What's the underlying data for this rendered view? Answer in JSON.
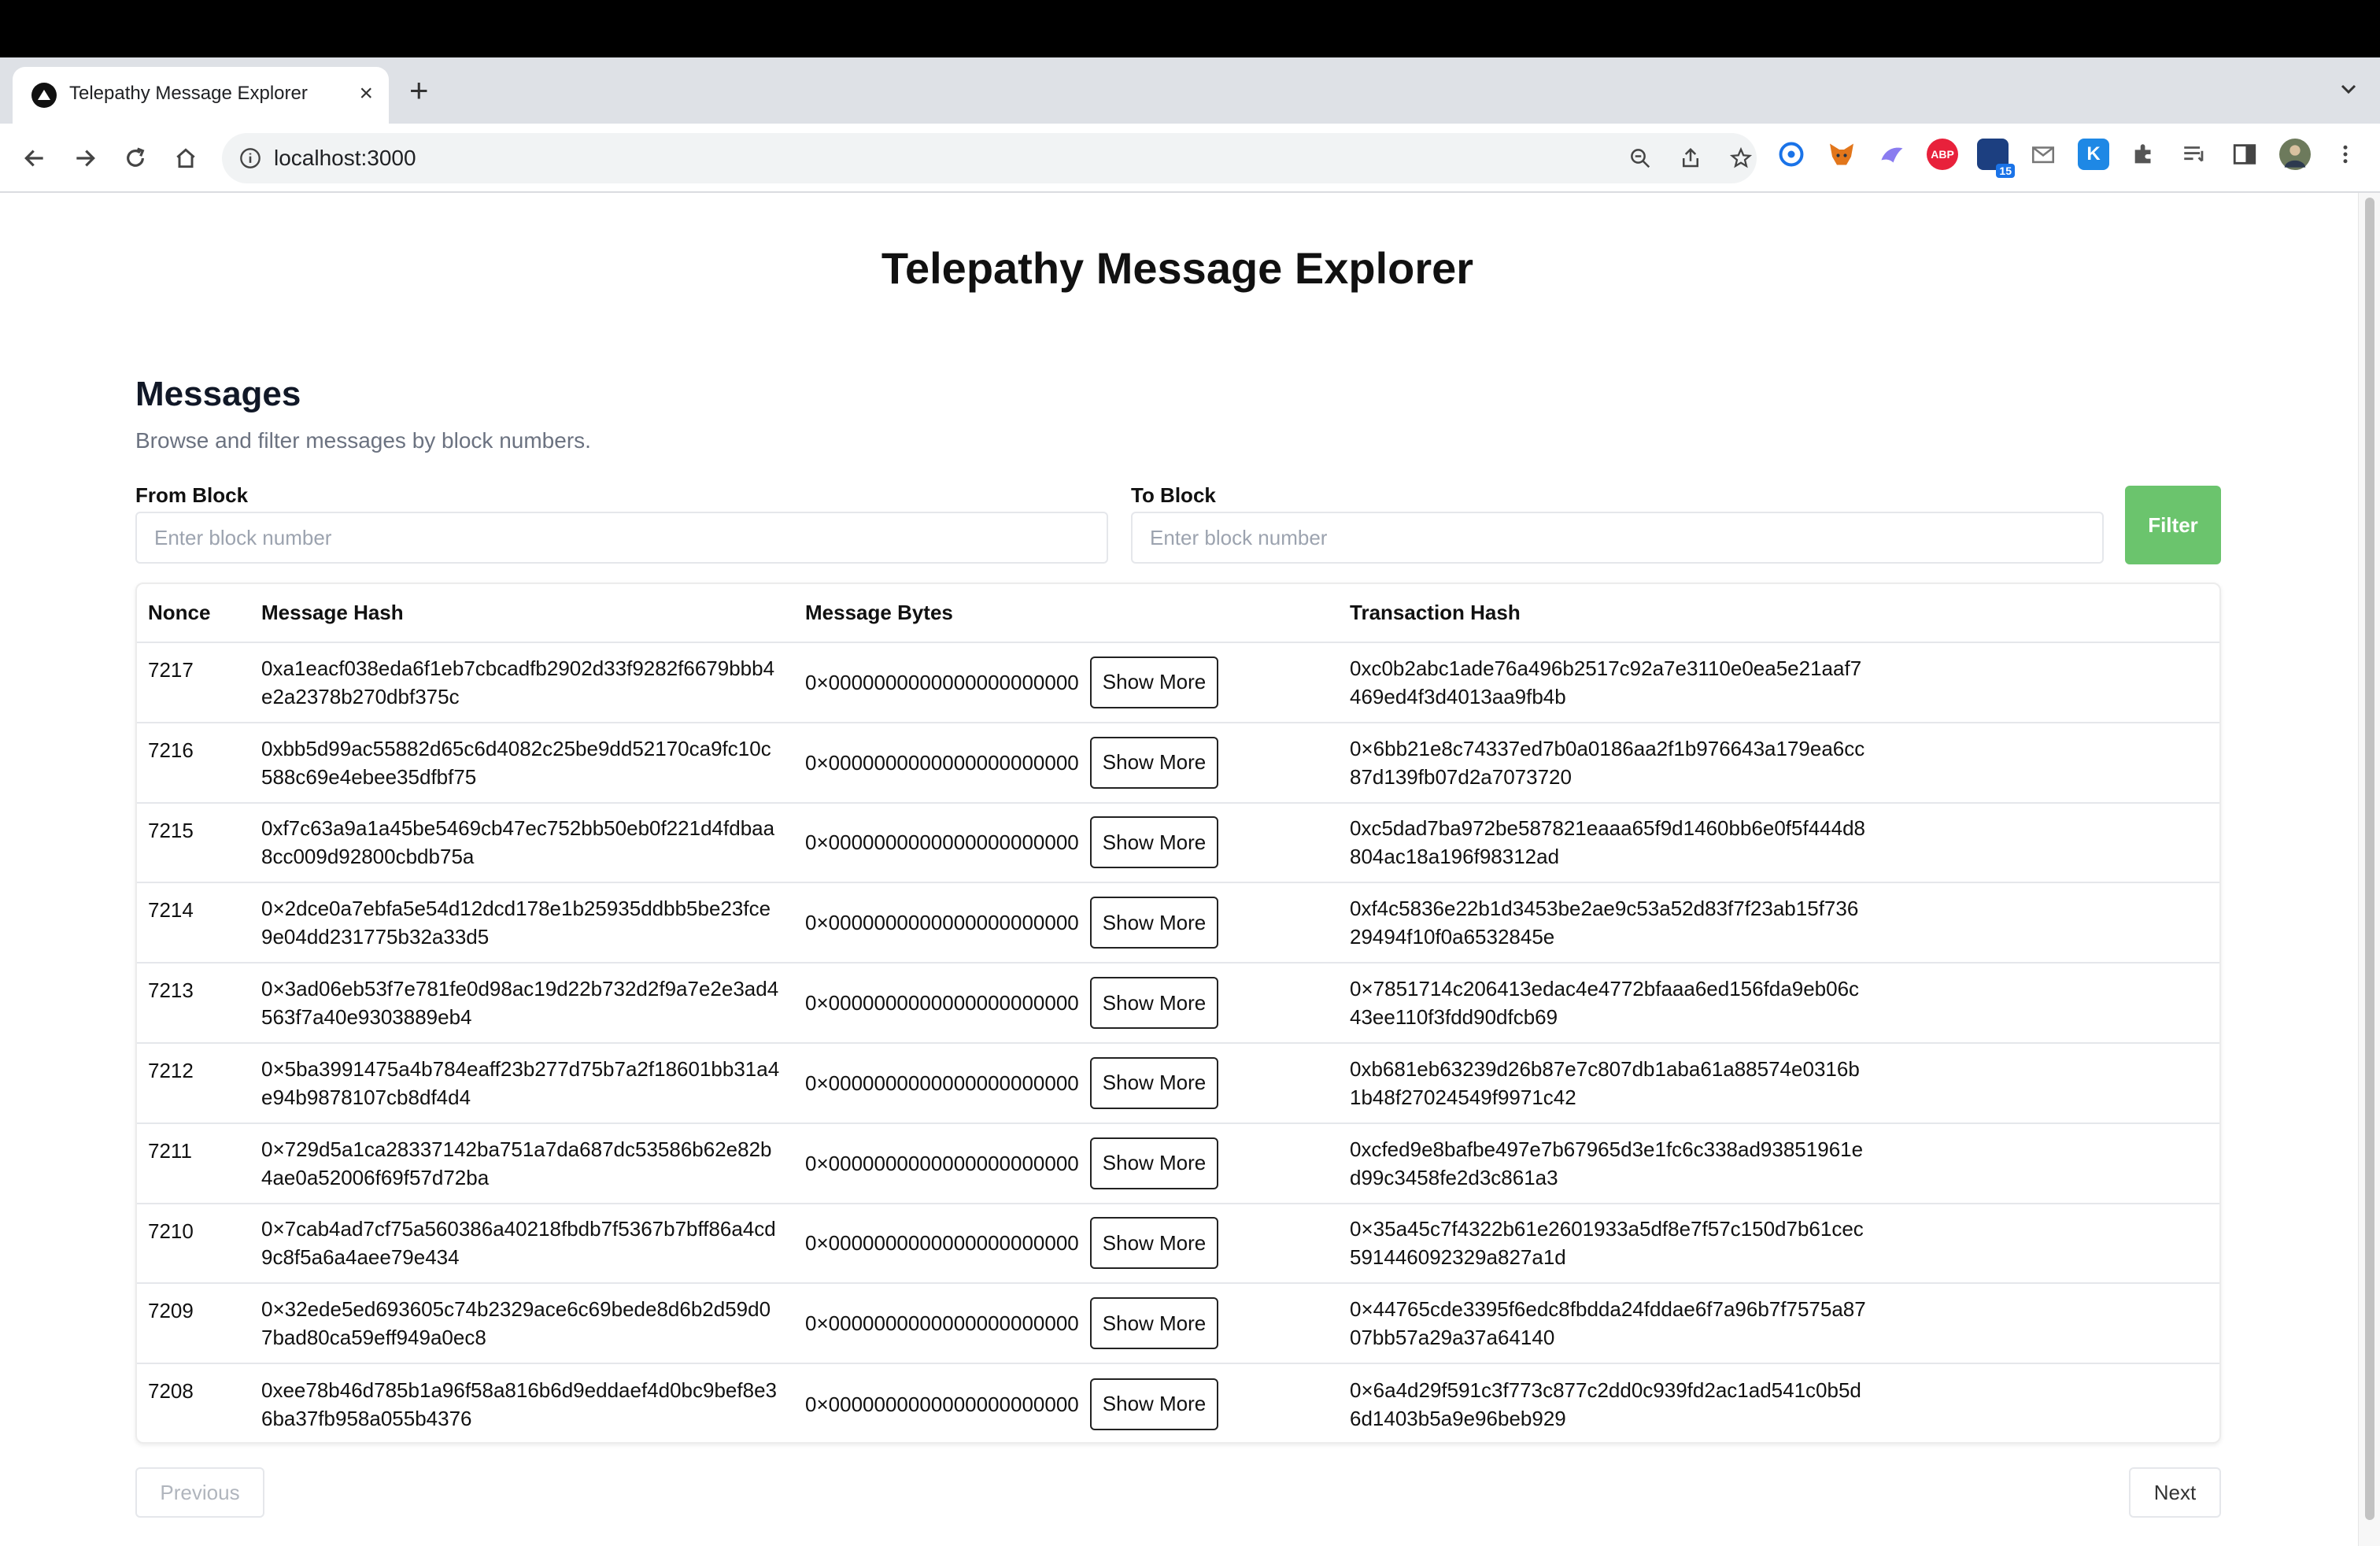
{
  "browser": {
    "tab_title": "Telepathy Message Explorer",
    "tab_close": "×",
    "new_tab": "+",
    "url": "localhost:3000",
    "badge_count": "15",
    "abp_label": "ABP",
    "k_label": "K"
  },
  "page": {
    "title": "Telepathy Message Explorer",
    "section_title": "Messages",
    "section_subtitle": "Browse and filter messages by block numbers."
  },
  "filter": {
    "from_label": "From Block",
    "from_placeholder": "Enter block number",
    "to_label": "To Block",
    "to_placeholder": "Enter block number",
    "button_label": "Filter"
  },
  "table": {
    "headers": {
      "nonce": "Nonce",
      "message_hash": "Message Hash",
      "message_bytes": "Message Bytes",
      "transaction_hash": "Transaction Hash"
    },
    "show_more_label": "Show More",
    "rows": [
      {
        "nonce": "7217",
        "message_hash": "0xa1eacf038eda6f1eb7cbcadfb2902d33f9282f6679bbb4e2a2378b270dbf375c",
        "message_bytes": "0×0000000000000000000000",
        "transaction_hash": "0xc0b2abc1ade76a496b2517c92a7e3110e0ea5e21aaf7469ed4f3d4013aa9fb4b"
      },
      {
        "nonce": "7216",
        "message_hash": "0xbb5d99ac55882d65c6d4082c25be9dd52170ca9fc10c588c69e4ebee35dfbf75",
        "message_bytes": "0×0000000000000000000000",
        "transaction_hash": "0×6bb21e8c74337ed7b0a0186aa2f1b976643a179ea6cc87d139fb07d2a7073720"
      },
      {
        "nonce": "7215",
        "message_hash": "0xf7c63a9a1a45be5469cb47ec752bb50eb0f221d4fdbaa8cc009d92800cbdb75a",
        "message_bytes": "0×0000000000000000000000",
        "transaction_hash": "0xc5dad7ba972be587821eaaa65f9d1460bb6e0f5f444d8804ac18a196f98312ad"
      },
      {
        "nonce": "7214",
        "message_hash": "0×2dce0a7ebfa5e54d12dcd178e1b25935ddbb5be23fce9e04dd231775b32a33d5",
        "message_bytes": "0×0000000000000000000000",
        "transaction_hash": "0xf4c5836e22b1d3453be2ae9c53a52d83f7f23ab15f73629494f10f0a6532845e"
      },
      {
        "nonce": "7213",
        "message_hash": "0×3ad06eb53f7e781fe0d98ac19d22b732d2f9a7e2e3ad4563f7a40e9303889eb4",
        "message_bytes": "0×0000000000000000000000",
        "transaction_hash": "0×7851714c206413edac4e4772bfaaa6ed156fda9eb06c43ee110f3fdd90dfcb69"
      },
      {
        "nonce": "7212",
        "message_hash": "0×5ba3991475a4b784eaff23b277d75b7a2f18601bb31a4e94b9878107cb8df4d4",
        "message_bytes": "0×0000000000000000000000",
        "transaction_hash": "0xb681eb63239d26b87e7c807db1aba61a88574e0316b1b48f27024549f9971c42"
      },
      {
        "nonce": "7211",
        "message_hash": "0×729d5a1ca28337142ba751a7da687dc53586b62e82b4ae0a52006f69f57d72ba",
        "message_bytes": "0×0000000000000000000000",
        "transaction_hash": "0xcfed9e8bafbe497e7b67965d3e1fc6c338ad93851961ed99c3458fe2d3c861a3"
      },
      {
        "nonce": "7210",
        "message_hash": "0×7cab4ad7cf75a560386a40218fbdb7f5367b7bff86a4cd9c8f5a6a4aee79e434",
        "message_bytes": "0×0000000000000000000000",
        "transaction_hash": "0×35a45c7f4322b61e2601933a5df8e7f57c150d7b61cec591446092329a827a1d"
      },
      {
        "nonce": "7209",
        "message_hash": "0×32ede5ed693605c74b2329ace6c69bede8d6b2d59d07bad80ca59eff949a0ec8",
        "message_bytes": "0×0000000000000000000000",
        "transaction_hash": "0×44765cde3395f6edc8fbdda24fddae6f7a96b7f7575a8707bb57a29a37a64140"
      },
      {
        "nonce": "7208",
        "message_hash": "0xee78b46d785b1a96f58a816b6d9eddaef4d0bc9bef8e36ba37fb958a055b4376",
        "message_bytes": "0×0000000000000000000000",
        "transaction_hash": "0×6a4d29f591c3f773c877c2dd0c939fd2ac1ad541c0b5d6d1403b5a9e96beb929"
      }
    ]
  },
  "pagination": {
    "previous_label": "Previous",
    "next_label": "Next"
  },
  "colors": {
    "filter_button": "#6bc46d",
    "text": "#111111",
    "muted": "#6b7280",
    "border": "#e5e7eb"
  }
}
